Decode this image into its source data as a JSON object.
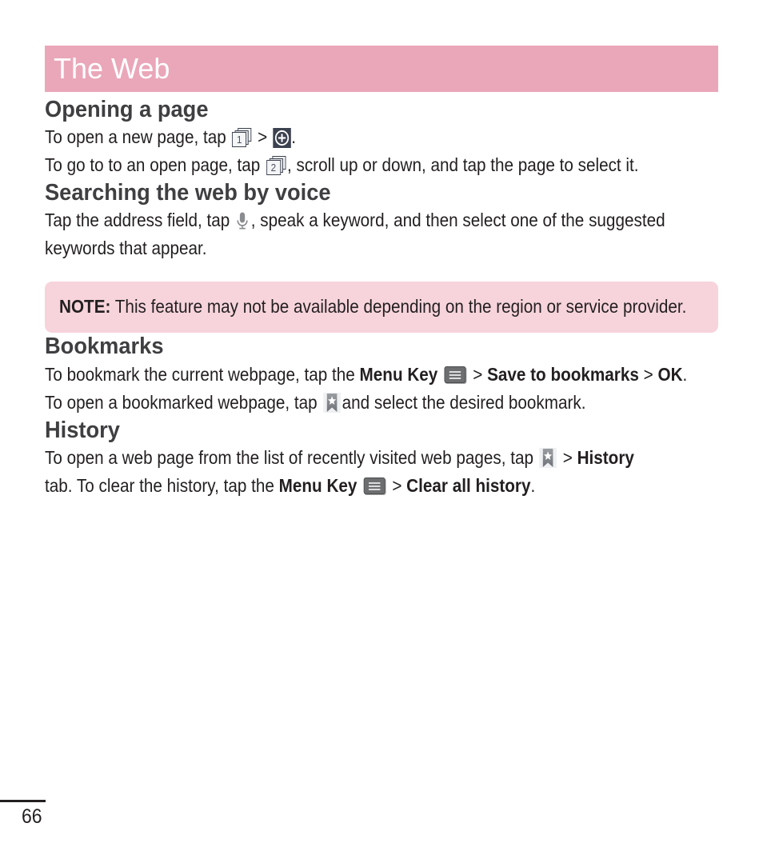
{
  "header": {
    "chapter_title": "The Web",
    "bar_color": "#eaa7b9"
  },
  "sections": {
    "opening": {
      "heading": "Opening a page",
      "line1_a": "To open a new page, tap",
      "line1_sep": ">",
      "line1_end": ".",
      "line2_a": "To go to to an open page, tap",
      "line2_b": ", scroll up or down, and tap the page to select it.",
      "tab_icon_1_label": "1",
      "tab_icon_2_label": "2"
    },
    "searching": {
      "heading": "Searching the web by voice",
      "line1_a": "Tap the address field, tap",
      "line1_b": ", speak a keyword, and then select one of the suggested keywords that appear."
    },
    "note": {
      "label": "NOTE:",
      "text": "This feature may not be available depending on the region or service provider.",
      "background_color": "#f7d4dc"
    },
    "bookmarks": {
      "heading": "Bookmarks",
      "line1_a": "To bookmark the current webpage, tap the",
      "menu_key_label": "Menu Key",
      "sep1": ">",
      "save_label": "Save to bookmarks",
      "sep2": ">",
      "ok_label": "OK",
      "period": ".",
      "line2_a": "To open a bookmarked webpage, tap",
      "line2_b": "and select the desired bookmark."
    },
    "history": {
      "heading": "History",
      "line1_a": "To open a web page from the list of recently visited web pages, tap",
      "sep1": ">",
      "history_tab_label": "History",
      "line2_a": "tab. To clear the history, tap the",
      "menu_key_label": "Menu Key",
      "sep2": ">",
      "clear_label": "Clear all history",
      "period": "."
    }
  },
  "footer": {
    "page_number": "66"
  }
}
